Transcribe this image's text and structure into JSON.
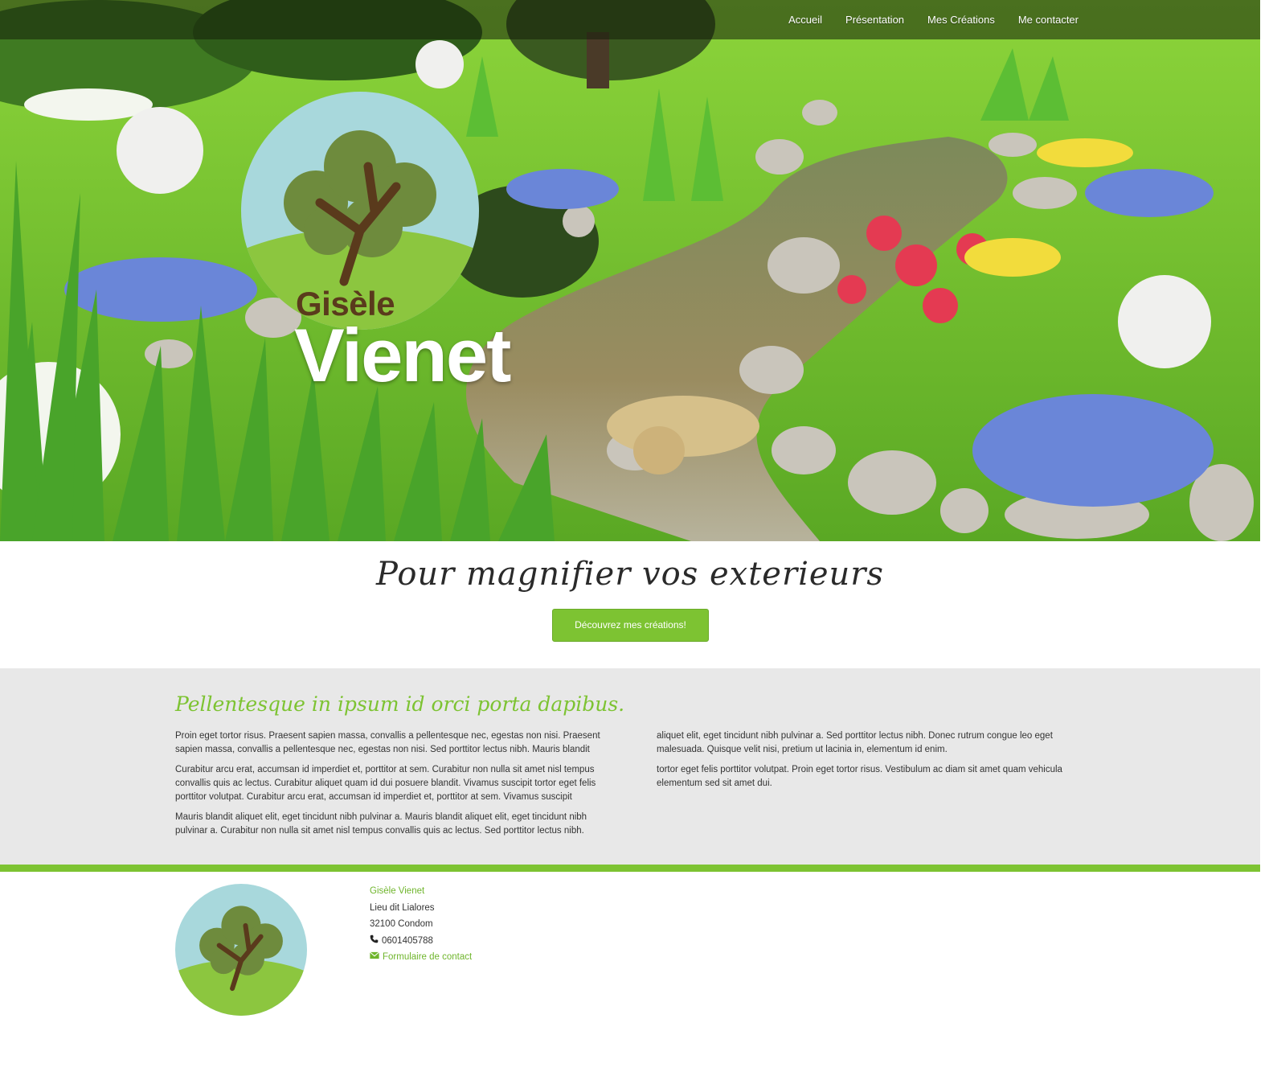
{
  "nav": {
    "items": [
      "Accueil",
      "Présentation",
      "Mes Créations",
      "Me contacter"
    ]
  },
  "hero": {
    "logo_firstname": "Gisèle",
    "logo_lastname": "Vienet"
  },
  "tagline": {
    "text": "Pour magnifier vos exterieurs",
    "button_label": "Découvrez mes créations!"
  },
  "intro": {
    "title": "Pellentesque in ipsum id orci porta dapibus.",
    "left_paragraphs": [
      "Proin eget tortor risus. Praesent sapien massa, convallis a pellentesque nec, egestas non nisi. Praesent sapien massa, convallis a pellentesque nec, egestas non nisi. Sed porttitor lectus nibh. Mauris blandit",
      "Curabitur arcu erat, accumsan id imperdiet et, porttitor at sem. Curabitur non nulla sit amet nisl tempus convallis quis ac lectus. Curabitur aliquet quam id dui posuere blandit. Vivamus suscipit tortor eget felis porttitor volutpat. Curabitur arcu erat, accumsan id imperdiet et, porttitor at sem. Vivamus suscipit",
      "Mauris blandit aliquet elit, eget tincidunt nibh pulvinar a. Mauris blandit aliquet elit, eget tincidunt nibh pulvinar a. Curabitur non nulla sit amet nisl tempus convallis quis ac lectus. Sed porttitor lectus nibh."
    ],
    "right_paragraphs": [
      "aliquet elit, eget tincidunt nibh pulvinar a. Sed porttitor lectus nibh. Donec rutrum congue leo eget malesuada. Quisque velit nisi, pretium ut lacinia in, elementum id enim.",
      "tortor eget felis porttitor volutpat. Proin eget tortor risus. Vestibulum ac diam sit amet quam vehicula elementum sed sit amet dui."
    ]
  },
  "footer": {
    "name": "Gisèle Vienet",
    "address_line1": "Lieu dit Lialores",
    "address_line2": "32100 Condom",
    "phone": "0601405788",
    "contact_link": "Formulaire de contact",
    "phone_icon": "phone-icon",
    "mail_icon": "envelope-icon"
  },
  "colors": {
    "accent_green": "#7dc332",
    "grey_bg": "#e8e8e8",
    "logo_sky": "#a8d8dc",
    "logo_hill": "#8cc63f",
    "logo_trunk": "#5a3a1c"
  }
}
